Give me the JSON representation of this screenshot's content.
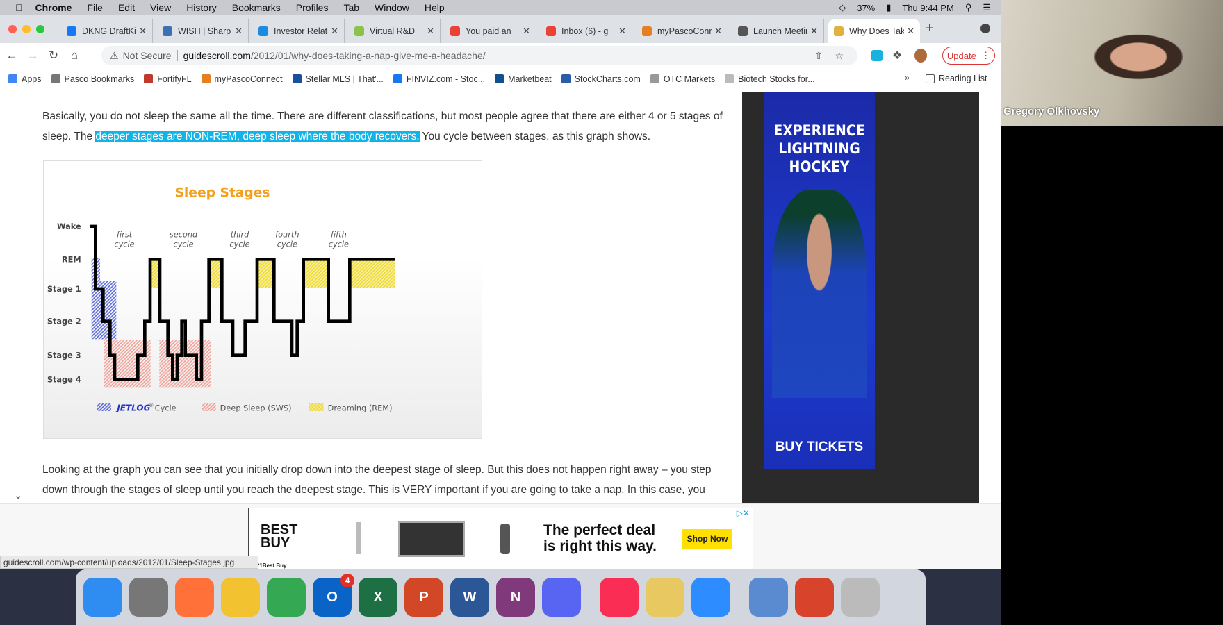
{
  "menubar": {
    "app": "Chrome",
    "items": [
      "File",
      "Edit",
      "View",
      "History",
      "Bookmarks",
      "Profiles",
      "Tab",
      "Window",
      "Help"
    ],
    "battery": "37%",
    "clock": "Thu 9:44 PM"
  },
  "tabs": [
    {
      "label": "DKNG DraftKings",
      "color": "#1877f2"
    },
    {
      "label": "WISH | Sharp",
      "color": "#3b6fb6"
    },
    {
      "label": "Investor Relations",
      "color": "#1a8be0"
    },
    {
      "label": "Virtual R&D",
      "color": "#8bc34a"
    },
    {
      "label": "You paid an",
      "color": "#ea4335"
    },
    {
      "label": "Inbox (6) - g",
      "color": "#ea4335"
    },
    {
      "label": "myPascoConnect",
      "color": "#e67e22"
    },
    {
      "label": "Launch Meeting",
      "color": "#555555"
    },
    {
      "label": "Why Does Taking",
      "color": "#e0b040",
      "active": true
    }
  ],
  "address": {
    "security": "Not Secure",
    "host": "guidescroll.com",
    "path": "/2012/01/why-does-taking-a-nap-give-me-a-headache/",
    "update_label": "Update"
  },
  "bookmarks": [
    {
      "label": "Apps",
      "color": "#4285f4"
    },
    {
      "label": "Pasco Bookmarks",
      "color": "#777777"
    },
    {
      "label": "FortifyFL",
      "color": "#c0392b"
    },
    {
      "label": "myPascoConnect",
      "color": "#e67e22"
    },
    {
      "label": "Stellar MLS | That'...",
      "color": "#1a4fa0"
    },
    {
      "label": "FINVIZ.com - Stoc...",
      "color": "#1877f2"
    },
    {
      "label": "Marketbeat",
      "color": "#124f8c"
    },
    {
      "label": "StockCharts.com",
      "color": "#2a5ca8"
    },
    {
      "label": "OTC Markets",
      "color": "#999999"
    },
    {
      "label": "Biotech Stocks for...",
      "color": "#bbbbbb"
    }
  ],
  "reading_list": "Reading List",
  "article": {
    "p1_before": "Basically, you do not sleep the same all the time. There are different classifications, but most people agree that there are either 4 or 5 stages of sleep. The ",
    "p1_highlight": "deeper stages are NON-REM, deep sleep where the body recovers.",
    "p1_after": " You cycle between stages, as this graph shows.",
    "p2": "Looking at the graph you can see that you initially drop down into the deepest stage of sleep. But this does not happen right away – you step down through the stages of sleep until you reach the deepest stage. This is VERY important if you are going to take a nap. In this case, you"
  },
  "figure": {
    "title": "Sleep Stages",
    "stages": [
      "Wake",
      "REM",
      "Stage 1",
      "Stage 2",
      "Stage 3",
      "Stage 4"
    ],
    "cycles": [
      [
        "first",
        "cycle"
      ],
      [
        "second",
        "cycle"
      ],
      [
        "third",
        "cycle"
      ],
      [
        "fourth",
        "cycle"
      ],
      [
        "fifth",
        "cycle"
      ]
    ],
    "legend": {
      "brand": "JETLOG",
      "reg": "®",
      "cycle": "Cycle",
      "deep": "Deep Sleep (SWS)",
      "dream": "Dreaming (REM)"
    },
    "colors": {
      "title": "#f5a01a",
      "cycle": "#2233cc",
      "deep": "#f06a5a",
      "dream": "#f2e24a"
    }
  },
  "sidebar_ad": {
    "headline": [
      "EXPERIENCE",
      "LIGHTNING",
      "HOCKEY"
    ],
    "cta": "BUY TICKETS"
  },
  "bottom_ad": {
    "brand": [
      "BEST",
      "BUY"
    ],
    "headline": [
      "The perfect deal",
      "is right this way."
    ],
    "cta": "Shop Now",
    "footer": "2021Best Buy"
  },
  "status_url": "guidescroll.com/wp-content/uploads/2012/01/Sleep-Stages.jpg",
  "dock": [
    {
      "name": "finder",
      "color": "#2f8cf0"
    },
    {
      "name": "launchpad",
      "color": "#777"
    },
    {
      "name": "firefox",
      "color": "#ff7139"
    },
    {
      "name": "app",
      "color": "#f2c230"
    },
    {
      "name": "chrome",
      "color": "#34a853"
    },
    {
      "name": "outlook",
      "color": "#0a64c8",
      "badge": "4",
      "glyph": "O"
    },
    {
      "name": "excel",
      "color": "#1d7044",
      "glyph": "X"
    },
    {
      "name": "powerpoint",
      "color": "#d24726",
      "glyph": "P"
    },
    {
      "name": "word",
      "color": "#2b5797",
      "glyph": "W"
    },
    {
      "name": "onenote",
      "color": "#80397b",
      "glyph": "N"
    },
    {
      "name": "discord",
      "color": "#5865f2"
    },
    {
      "name": "music",
      "color": "#fa2d55"
    },
    {
      "name": "grapher",
      "color": "#e8c860"
    },
    {
      "name": "zoom",
      "color": "#2d8cff"
    },
    {
      "name": "utility",
      "color": "#5a8bd0"
    },
    {
      "name": "mypasco",
      "color": "#d8432b"
    },
    {
      "name": "trash",
      "color": "#bbbbbb"
    }
  ],
  "webcam": {
    "name": "Gregory Olkhovsky"
  }
}
